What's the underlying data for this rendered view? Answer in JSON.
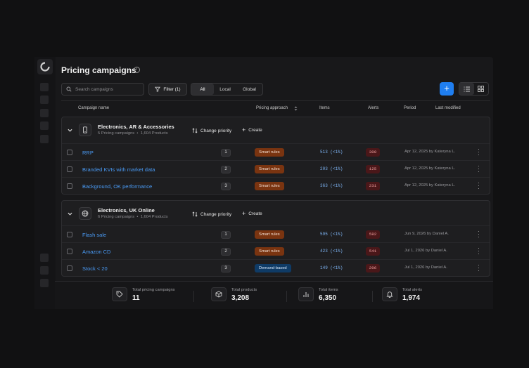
{
  "page": {
    "title": "Pricing campaigns"
  },
  "toolbar": {
    "search_placeholder": "Search campaigns",
    "filter_label": "Filter (1)",
    "scope_tabs": [
      "All",
      "Local",
      "Global"
    ],
    "add_label": "+"
  },
  "table": {
    "columns": {
      "campaign": "Campaign name",
      "approach": "Pricing approach",
      "items": "Items",
      "alerts": "Alerts",
      "period": "Period",
      "modified": "Last modified"
    }
  },
  "groups": [
    {
      "name": "Electronics, AR & Accessories",
      "campaigns_count": "5 Pricing campaigns",
      "products_count": "1,604 Products",
      "change_priority": "Change priority",
      "create": "Create",
      "rows": [
        {
          "name": "RRP",
          "priority": "1",
          "approach": "Smart rules",
          "items": "513 (<1%)",
          "alerts": "300",
          "modified": "Apr 12, 2025 by Kateryna L."
        },
        {
          "name": "Branded KVIs with market data",
          "priority": "2",
          "approach": "Smart rules",
          "items": "203 (<1%)",
          "alerts": "125",
          "modified": "Apr 12, 2025 by Kateryna L."
        },
        {
          "name": "Background, OK performance",
          "priority": "3",
          "approach": "Smart rules",
          "items": "363 (<1%)",
          "alerts": "231",
          "modified": "Apr 12, 2025 by Kateryna L."
        }
      ]
    },
    {
      "name": "Electronics, UK Online",
      "campaigns_count": "6 Pricing campaigns",
      "products_count": "1,604 Products",
      "change_priority": "Change priority",
      "create": "Create",
      "rows": [
        {
          "name": "Flash sale",
          "priority": "1",
          "approach": "Smart rules",
          "items": "595 (<1%)",
          "alerts": "582",
          "modified": "Jun 9, 2026 by Daniel A."
        },
        {
          "name": "Amazon CD",
          "priority": "2",
          "approach": "Smart rules",
          "items": "423 (<1%)",
          "alerts": "541",
          "modified": "Jul 1, 2026 by Daniel A."
        },
        {
          "name": "Stock < 20",
          "priority": "3",
          "approach": "Demand-based",
          "items": "149 (<1%)",
          "alerts": "206",
          "modified": "Jul 1, 2026 by Daniel A."
        }
      ]
    }
  ],
  "summary": [
    {
      "label": "Total pricing campaigns",
      "value": "11",
      "icon": "tag-icon"
    },
    {
      "label": "Total products",
      "value": "3,208",
      "icon": "box-icon"
    },
    {
      "label": "Total items",
      "value": "6,350",
      "icon": "bar-chart-icon"
    },
    {
      "label": "Total alerts",
      "value": "1,974",
      "icon": "bell-icon"
    }
  ],
  "colors": {
    "accent": "#1f7ef0",
    "smart_rules": "#7a3410",
    "demand_based": "#0f3b66",
    "alert_bg": "#4a1719",
    "link": "#4a9bf5"
  }
}
